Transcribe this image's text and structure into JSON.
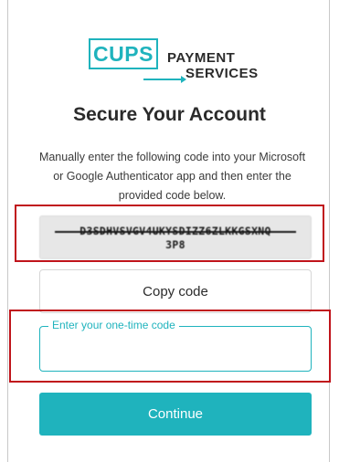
{
  "brand": {
    "logo_box_text": "CUPS",
    "logo_line1": "PAYMENT",
    "logo_line2": "SERVICES",
    "accent_color": "#1fb3bd",
    "highlight_color": "#c0141b"
  },
  "page": {
    "title": "Secure Your Account",
    "instructions": "Manually enter the following code into your Microsoft or Google Authenticator app and then enter the provided code below."
  },
  "secret": {
    "line1": "D3SDHVSVGV4UKYSDIZZ6ZLKKGSXNQ",
    "line2": "3P8"
  },
  "actions": {
    "copy_label": "Copy code",
    "continue_label": "Continue"
  },
  "otp": {
    "label": "Enter your one-time code",
    "value": ""
  }
}
